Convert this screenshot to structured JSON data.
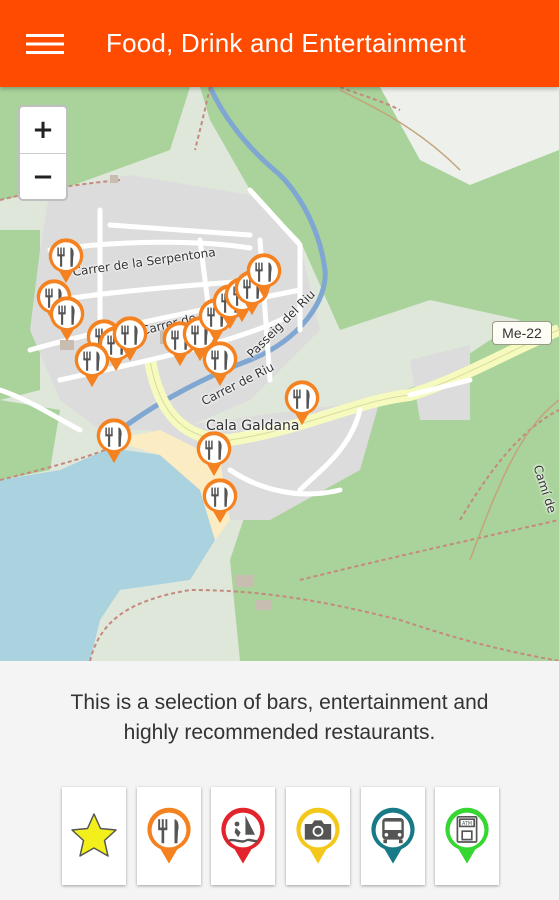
{
  "app_bar": {
    "title": "Food, Drink and Entertainment",
    "menu_icon": "hamburger-menu-icon",
    "color": "#ff4b00"
  },
  "map": {
    "zoom_in_label": "+",
    "zoom_out_label": "−",
    "road_labels": [
      "Carrer de la Serpentona",
      "Carrer de Can",
      "Passeig del Riu",
      "Carrer de Riu",
      "Camí de"
    ],
    "place_label": "Cala Galdana",
    "route_shield": "Me-22",
    "marker_icon": "restaurant-marker-icon",
    "marker_color": "#f58220",
    "marker_count": 19
  },
  "description": {
    "line1": "This is a selection of bars, entertainment and",
    "line2": "highly recommended restaurants."
  },
  "categories": [
    {
      "name": "favorites",
      "icon": "star-icon",
      "color": "#f2ef1b"
    },
    {
      "name": "food",
      "icon": "restaurant-marker-icon",
      "color": "#f58220"
    },
    {
      "name": "water-sports",
      "icon": "windsurf-marker-icon",
      "color": "#e3232b"
    },
    {
      "name": "sightseeing",
      "icon": "camera-marker-icon",
      "color": "#f3c81b"
    },
    {
      "name": "transport",
      "icon": "bus-marker-icon",
      "color": "#177a86"
    },
    {
      "name": "atm",
      "icon": "atm-marker-icon",
      "color": "#36d633"
    }
  ]
}
